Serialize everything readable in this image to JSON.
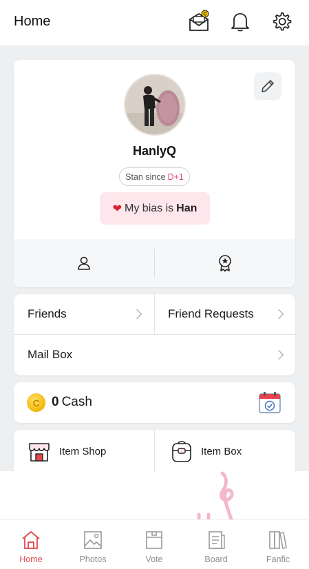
{
  "header": {
    "title": "Home",
    "icons": [
      "mail-coin-icon",
      "bell-icon",
      "gear-icon"
    ]
  },
  "profile": {
    "username": "HanlyQ",
    "stan_since_label": "Stan since",
    "stan_since_value": "D+1",
    "bias_label": "My bias is",
    "bias_name": "Han"
  },
  "menu": {
    "friends": "Friends",
    "friend_requests": "Friend Requests",
    "mail_box": "Mail Box"
  },
  "cash": {
    "amount": "0",
    "label": "Cash"
  },
  "shop": {
    "item_shop": "Item Shop",
    "item_box": "Item Box"
  },
  "nav": {
    "items": [
      {
        "label": "Home",
        "active": true
      },
      {
        "label": "Photos",
        "active": false
      },
      {
        "label": "Vote",
        "active": false
      },
      {
        "label": "Board",
        "active": false
      },
      {
        "label": "Fanfic",
        "active": false
      }
    ]
  },
  "colors": {
    "accent": "#e0464f",
    "bias_bg": "#fde6ec",
    "coin": "#f2b705"
  }
}
